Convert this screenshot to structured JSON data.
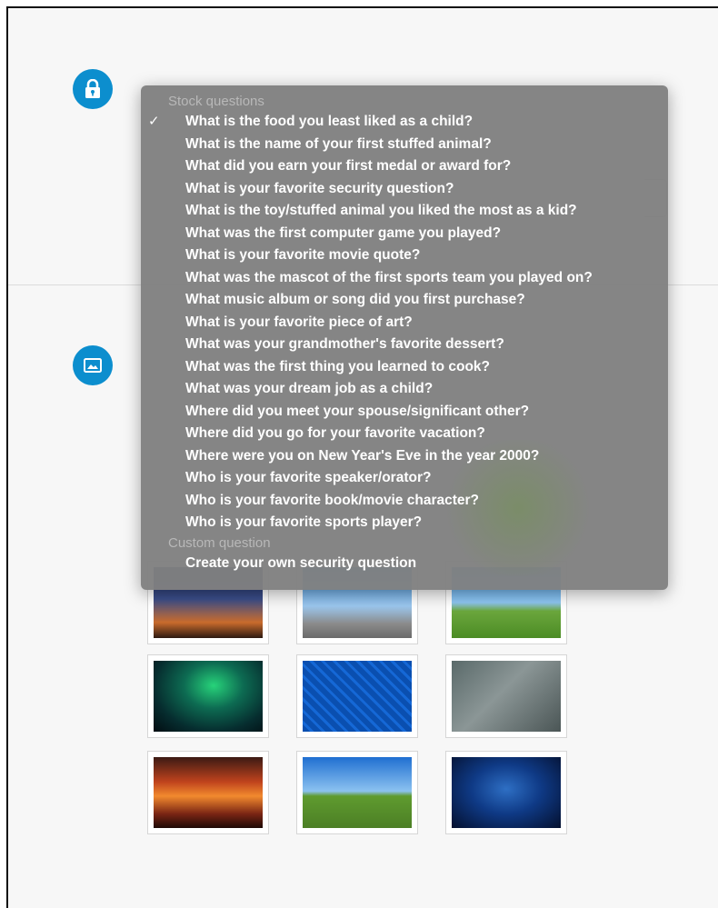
{
  "dropdown": {
    "stock_header": "Stock questions",
    "selected_mark": "✓",
    "stock_questions": [
      "What is the food you least liked as a child?",
      "What is the name of your first stuffed animal?",
      "What did you earn your first medal or award for?",
      "What is your favorite security question?",
      "What is the toy/stuffed animal you liked the most as a kid?",
      "What was the first computer game you played?",
      "What is your favorite movie quote?",
      "What was the mascot of the first sports team you played on?",
      "What music album or song did you first purchase?",
      "What is your favorite piece of art?",
      "What was your grandmother's favorite dessert?",
      "What was the first thing you learned to cook?",
      "What was your dream job as a child?",
      "Where did you meet your spouse/significant other?",
      "Where did you go for your favorite vacation?",
      "Where were you on New Year's Eve in the year 2000?",
      "Who is your favorite speaker/orator?",
      "Who is your favorite book/movie character?",
      "Who is your favorite sports player?"
    ],
    "custom_header": "Custom question",
    "custom_item": "Create your own security question"
  },
  "icons": {
    "security": "lock-icon",
    "image": "picture-icon"
  },
  "images": [
    "bridge-image",
    "brooklyn-bridge-image",
    "sheep-image",
    "aurora-image",
    "circuit-board-image",
    "robot-image",
    "sunset-clouds-image",
    "road-image",
    "stingray-image"
  ],
  "colors": {
    "accent": "#0c8ece",
    "menu_bg": "#808080",
    "menu_header": "#b8b8b8"
  }
}
